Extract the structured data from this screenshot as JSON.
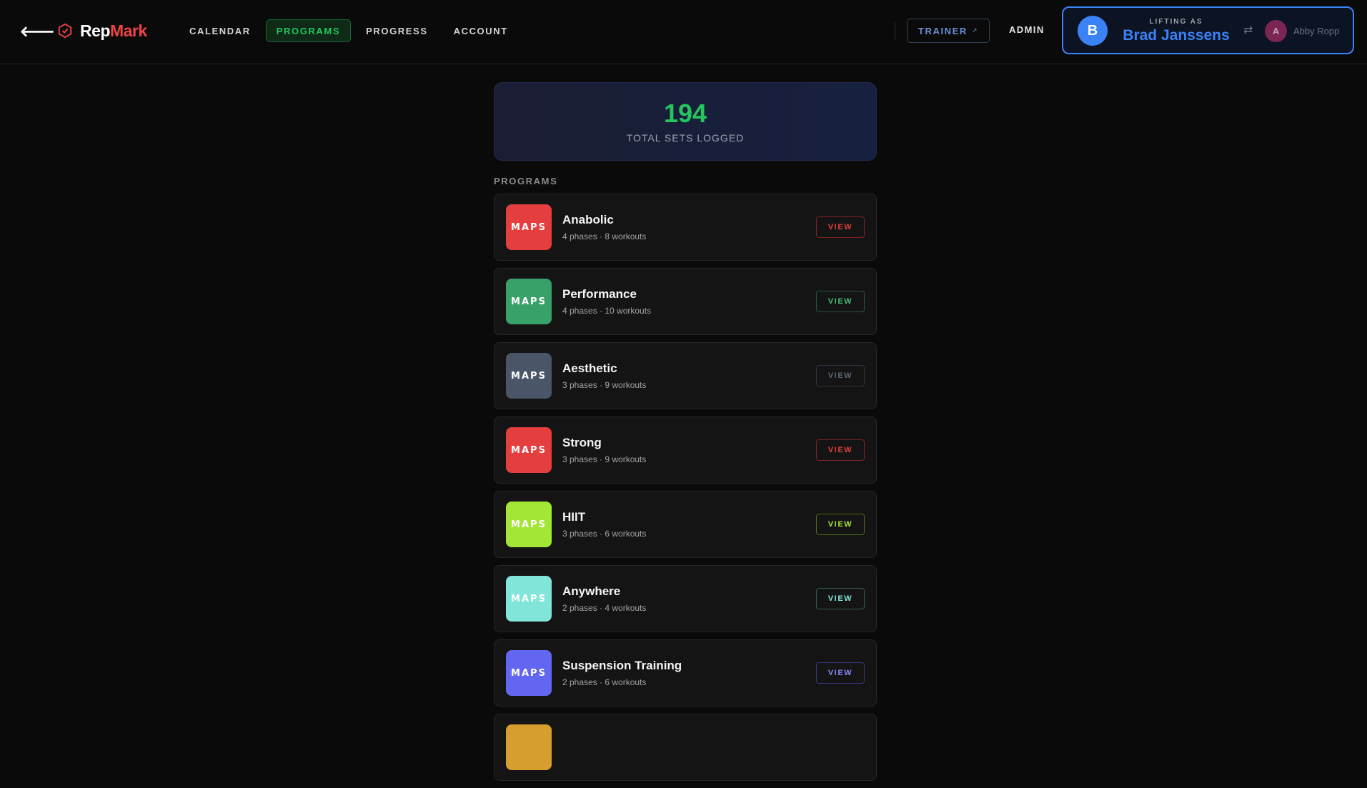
{
  "header": {
    "back_icon": "arrow-left-icon",
    "back_glyph": "⟵",
    "logo_icon": "hexagon-check-icon",
    "logo_rep": "Rep",
    "logo_mark": "Mark",
    "nav": [
      {
        "label": "CALENDAR",
        "active": false
      },
      {
        "label": "PROGRAMS",
        "active": true
      },
      {
        "label": "PROGRESS",
        "active": false
      },
      {
        "label": "ACCOUNT",
        "active": false
      }
    ],
    "trainer_label": "TRAINER",
    "trainer_icon": "external-link-icon",
    "trainer_glyph": "↗",
    "admin_label": "ADMIN",
    "lifting": {
      "label": "LIFTING AS",
      "initial": "B",
      "name": "Brad Janssens",
      "swap_glyph": "⇄",
      "alt_initial": "A",
      "alt_name": "Abby Ropp"
    }
  },
  "stats": {
    "value": "194",
    "label": "TOTAL SETS LOGGED"
  },
  "programs_title": "PROGRAMS",
  "programs": [
    {
      "badge": "MAPS",
      "name": "Anabolic",
      "meta": "4 phases · 8 workouts",
      "view": "VIEW",
      "color": "#e53e3e",
      "btn_color": "#e53e3e",
      "btn_border": "#7a2424"
    },
    {
      "badge": "MAPS",
      "name": "Performance",
      "meta": "4 phases · 10 workouts",
      "view": "VIEW",
      "color": "#38a169",
      "btn_color": "#48bb78",
      "btn_border": "#22543d"
    },
    {
      "badge": "MAPS",
      "name": "Aesthetic",
      "meta": "3 phases · 9 workouts",
      "view": "VIEW",
      "color": "#4a5568",
      "btn_color": "#5a6578",
      "btn_border": "#2d3340"
    },
    {
      "badge": "MAPS",
      "name": "Strong",
      "meta": "3 phases · 9 workouts",
      "view": "VIEW",
      "color": "#e53e3e",
      "btn_color": "#e53e3e",
      "btn_border": "#7a2424"
    },
    {
      "badge": "MAPS",
      "name": "HIIT",
      "meta": "3 phases · 6 workouts",
      "view": "VIEW",
      "color": "#a3e635",
      "btn_color": "#a3e635",
      "btn_border": "#4d6b1a"
    },
    {
      "badge": "MAPS",
      "name": "Anywhere",
      "meta": "2 phases · 4 workouts",
      "view": "VIEW",
      "color": "#81e6d9",
      "btn_color": "#81e6d9",
      "btn_border": "#2f5a55"
    },
    {
      "badge": "MAPS",
      "name": "Suspension Training",
      "meta": "2 phases · 6 workouts",
      "view": "VIEW",
      "color": "#6366f1",
      "btn_color": "#818cf8",
      "btn_border": "#34367a"
    },
    {
      "badge": "",
      "name": "",
      "meta": "",
      "view": "",
      "color": "#d69e2e",
      "btn_color": "#d69e2e",
      "btn_border": "#6b4f17"
    }
  ]
}
